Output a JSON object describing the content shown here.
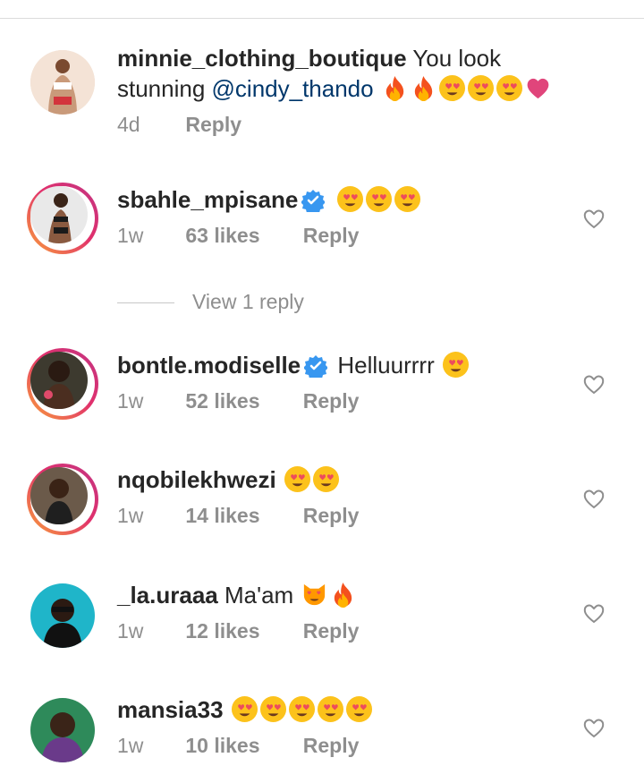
{
  "comments": [
    {
      "username": "minnie_clothing_boutique",
      "text": "You look stunning ",
      "mention": "@cindy_thando",
      "time": "4d",
      "likes": "",
      "reply": "Reply",
      "verified": false,
      "emojis": [
        "fire-emoji",
        "fire-emoji",
        "heart-eyes-emoji",
        "heart-eyes-emoji",
        "heart-eyes-emoji",
        "pink-heart-emoji"
      ]
    },
    {
      "username": "sbahle_mpisane",
      "text": "",
      "time": "1w",
      "likes": "63 likes",
      "reply": "Reply",
      "verified": true,
      "emojis": [
        "heart-eyes-emoji",
        "heart-eyes-emoji",
        "heart-eyes-emoji"
      ]
    },
    {
      "username": "bontle.modiselle",
      "text": "Helluurrrr",
      "time": "1w",
      "likes": "52 likes",
      "reply": "Reply",
      "verified": true,
      "emojis": [
        "heart-eyes-emoji"
      ]
    },
    {
      "username": "nqobilekhwezi",
      "text": "",
      "time": "1w",
      "likes": "14 likes",
      "reply": "Reply",
      "verified": false,
      "emojis": [
        "heart-eyes-emoji",
        "heart-eyes-emoji"
      ]
    },
    {
      "username": "_la.uraaa",
      "text": "Ma'am",
      "time": "1w",
      "likes": "12 likes",
      "reply": "Reply",
      "verified": false,
      "emojis": [
        "heart-eyes-cat-emoji",
        "fire-emoji"
      ]
    },
    {
      "username": "mansia33",
      "text": "",
      "time": "1w",
      "likes": "10 likes",
      "reply": "Reply",
      "verified": false,
      "emojis": [
        "heart-eyes-emoji",
        "heart-eyes-emoji",
        "heart-eyes-emoji",
        "heart-eyes-emoji",
        "heart-eyes-emoji"
      ]
    }
  ],
  "view_replies": "View 1 reply",
  "colors": {
    "text": "#262626",
    "muted": "#8e8e8e",
    "mention": "#00376b",
    "verified": "#3897f0",
    "divider": "#dbdbdb"
  }
}
